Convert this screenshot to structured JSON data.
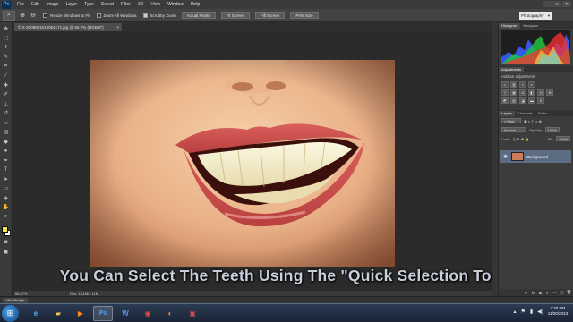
{
  "app": {
    "logo": "Ps",
    "menu": [
      "File",
      "Edit",
      "Image",
      "Layer",
      "Type",
      "Select",
      "Filter",
      "3D",
      "View",
      "Window",
      "Help"
    ],
    "window_controls": [
      "—",
      "□",
      "✕"
    ]
  },
  "options": {
    "checkbox_1": "Resize Windows to Fit",
    "checkbox_2": "Zoom All Windows",
    "checkbox_3": "Scrubby Zoom",
    "btn_actual": "Actual Pixels",
    "btn_fit": "Fit Screen",
    "btn_fill": "Fill Screen",
    "btn_print": "Print Size",
    "workspace": "Photography"
  },
  "document": {
    "tab_title": "© X-2009081613054171.jpg @ 66.7% (RGB/8*)",
    "zoom": "66.67%",
    "doc_size": "Doc: 1.11M/1.11M"
  },
  "caption": "You Can Select The Teeth Using The \"Quick Selection Tool\"",
  "panels": {
    "histogram_tab": "Histogram",
    "navigator_tab": "Navigator",
    "adjustments_tab": "Adjustments",
    "add_adjustment": "Add an adjustment",
    "layers_tab": "Layers",
    "channels_tab": "Channels",
    "paths_tab": "Paths",
    "kind": "Kind",
    "blend_mode": "Normal",
    "opacity_label": "Opacity:",
    "opacity": "100%",
    "lock_label": "Lock:",
    "fill_label": "Fill:",
    "fill": "100%",
    "layer_name": "Background"
  },
  "minibridge": {
    "label": "Mini Bridge"
  },
  "taskbar": {
    "time": "2:20 PM",
    "date": "11/20/2013"
  }
}
